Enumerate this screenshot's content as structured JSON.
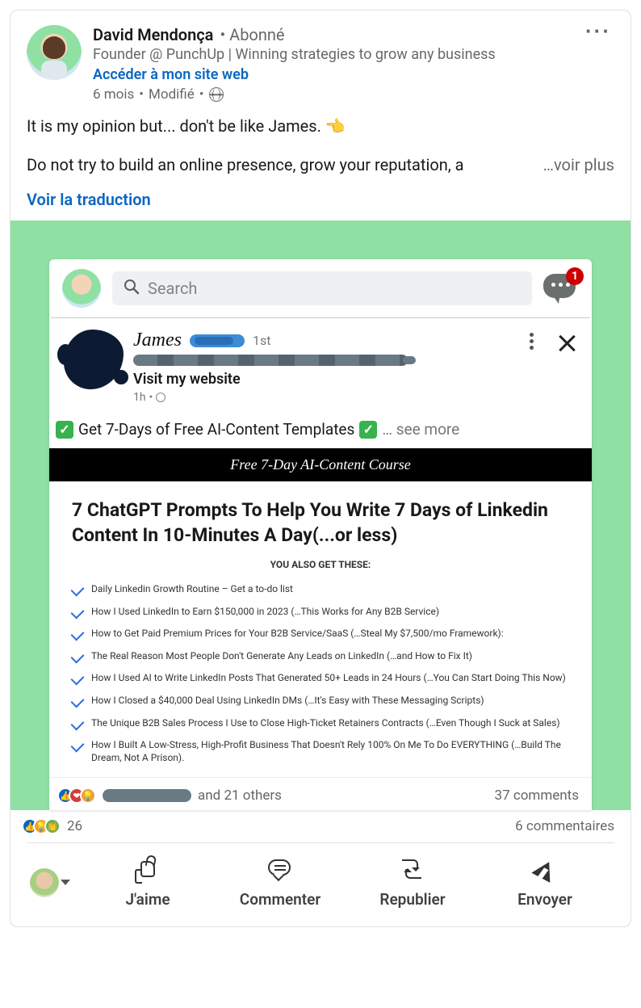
{
  "post": {
    "author_name": "David Mendonça",
    "relation": "Abonné",
    "headline": "Founder @ PunchUp | Winning strategies to grow any business",
    "website_link": "Accéder à mon site web",
    "age": "6 mois",
    "edited": "Modifié",
    "body_line1": "It is my opinion but... don't be like James. 👈",
    "body_line2": "Do not try to build an online presence, grow your reputation, a",
    "see_more": "…voir plus",
    "translate": "Voir la traduction"
  },
  "embedded": {
    "search_placeholder": "Search",
    "notif_count": "1",
    "inner_author": "James",
    "degree": "1st",
    "visit": "Visit my website",
    "inner_time": "1h",
    "offer_text": "Get 7-Days of Free AI-Content Templates",
    "offer_more": "… see more",
    "black_bar": "Free 7-Day AI-Content Course",
    "prompt_title": "7 ChatGPT Prompts To Help You Write 7 Days of Linkedin Content In 10-Minutes A Day(...or less)",
    "also_get": "YOU ALSO GET THESE:",
    "bullets": [
      "Daily Linkedin Growth Routine – Get a to-do list",
      "How I Used LinkedIn to Earn $150,000 in 2023 (…This Works for Any B2B Service)",
      "How to Get Paid Premium Prices for Your B2B Service/SaaS (…Steal My $7,500/mo Framework):",
      "The Real Reason Most People Don't Generate Any Leads on LinkedIn (…and How to Fix It)",
      "How I Used AI to Write LinkedIn Posts That Generated 50+ Leads in 24 Hours (…You Can Start Doing This Now)",
      "How I Closed a $40,000 Deal Using LinkedIn DMs (…It's Easy with These Messaging Scripts)",
      "The Unique B2B Sales Process I Use to Close High-Ticket Retainers Contracts (…Even Though I Suck at Sales)",
      "How I Built A Low-Stress, High-Profit Business That Doesn't Rely 100% On Me To Do EVERYTHING (…Build The Dream, Not A Prison)."
    ],
    "others_text": "and 21 others",
    "comments_text": "37 comments"
  },
  "outer_social": {
    "count": "26",
    "comments": "6 commentaires"
  },
  "actions": {
    "like": "J'aime",
    "comment": "Commenter",
    "repost": "Republier",
    "send": "Envoyer"
  }
}
